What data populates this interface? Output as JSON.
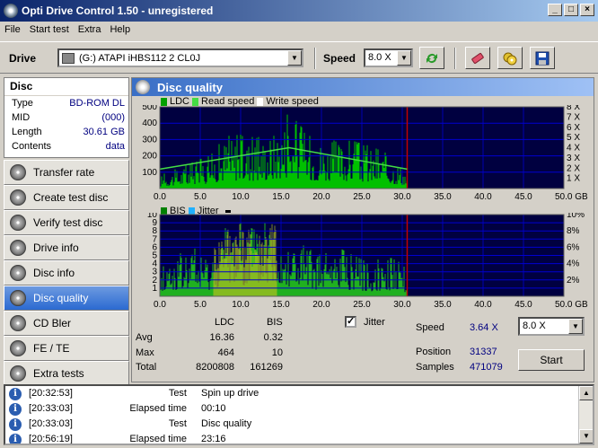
{
  "window": {
    "title": "Opti Drive Control 1.50 - unregistered"
  },
  "menu": [
    "File",
    "Start test",
    "Extra",
    "Help"
  ],
  "toolbar": {
    "drive_label": "Drive",
    "drive_value": "(G:)   ATAPI iHBS112   2 CL0J",
    "speed_label": "Speed",
    "speed_value": "8.0 X"
  },
  "disc": {
    "header": "Disc",
    "rows": [
      {
        "key": "Type",
        "value": "BD-ROM DL"
      },
      {
        "key": "MID",
        "value": "(000)"
      },
      {
        "key": "Length",
        "value": "30.61 GB"
      },
      {
        "key": "Contents",
        "value": "data"
      }
    ]
  },
  "nav": [
    {
      "label": "Transfer rate"
    },
    {
      "label": "Create test disc"
    },
    {
      "label": "Verify test disc"
    },
    {
      "label": "Drive info"
    },
    {
      "label": "Disc info"
    },
    {
      "label": "Disc quality",
      "active": true
    },
    {
      "label": "CD Bler"
    },
    {
      "label": "FE / TE"
    },
    {
      "label": "Extra tests"
    }
  ],
  "panel": {
    "title": "Disc quality"
  },
  "legend_top": {
    "ldc": "LDC",
    "read": "Read speed",
    "write": "Write speed"
  },
  "legend_bottom": {
    "bis": "BIS",
    "jitter": "Jitter"
  },
  "chart_data": [
    {
      "type": "area",
      "name": "LDC chart",
      "x_ticks": [
        "0.0",
        "5.0",
        "10.0",
        "15.0",
        "20.0",
        "25.0",
        "30.0",
        "35.0",
        "40.0",
        "45.0",
        "50.0 GB"
      ],
      "y_left_ticks": [
        "100",
        "200",
        "300",
        "400",
        "500"
      ],
      "y_right_ticks": [
        "1 X",
        "2 X",
        "3 X",
        "4 X",
        "5 X",
        "6 X",
        "7 X",
        "8 X"
      ],
      "xlim": [
        0,
        50
      ],
      "ylim": [
        0,
        500
      ],
      "data_end_gb": 30.61,
      "read_speed": {
        "x": [
          0,
          16,
          30.6
        ],
        "y": [
          1.9,
          4.0,
          1.9
        ]
      },
      "ldc_envelope": {
        "x": [
          0,
          2,
          4,
          6,
          8,
          10,
          12,
          14,
          16,
          18,
          20,
          22,
          24,
          26,
          28,
          30,
          30.6
        ],
        "y": [
          80,
          120,
          160,
          200,
          320,
          330,
          310,
          360,
          464,
          350,
          310,
          300,
          290,
          260,
          220,
          150,
          100
        ]
      },
      "colors": {
        "ldc": "#00c000",
        "read": "#44dd44",
        "grid": "#0000c0",
        "bg": "#000040",
        "marker": "#c00000"
      }
    },
    {
      "type": "area",
      "name": "BIS chart",
      "x_ticks": [
        "0.0",
        "5.0",
        "10.0",
        "15.0",
        "20.0",
        "25.0",
        "30.0",
        "35.0",
        "40.0",
        "45.0",
        "50.0 GB"
      ],
      "y_left_ticks": [
        "1",
        "2",
        "3",
        "4",
        "5",
        "6",
        "7",
        "8",
        "9",
        "10"
      ],
      "y_right_ticks": [
        "2%",
        "4%",
        "6%",
        "8%",
        "10%"
      ],
      "xlim": [
        0,
        50
      ],
      "ylim": [
        0,
        10
      ],
      "data_end_gb": 30.61,
      "bis_envelope": {
        "x": [
          0,
          2,
          4,
          6,
          8,
          10,
          12,
          14,
          16,
          18,
          20,
          22,
          24,
          26,
          28,
          30,
          30.6
        ],
        "y": [
          4,
          5,
          6,
          5,
          9,
          9,
          8,
          10,
          8,
          6,
          5,
          6,
          5,
          4,
          5,
          4,
          3
        ]
      },
      "colors": {
        "bis": "#20b020",
        "bis_mid": "#b0c020"
      }
    }
  ],
  "stats": {
    "col_ldc": "LDC",
    "col_bis": "BIS",
    "rows": [
      {
        "label": "Avg",
        "ldc": "16.36",
        "bis": "0.32"
      },
      {
        "label": "Max",
        "ldc": "464",
        "bis": "10"
      },
      {
        "label": "Total",
        "ldc": "8200808",
        "bis": "161269"
      }
    ],
    "jitter_label": "Jitter",
    "speed_label": "Speed",
    "speed_value": "3.64 X",
    "position_label": "Position",
    "position_value": "31337",
    "samples_label": "Samples",
    "samples_value": "471079",
    "speed_select": "8.0 X",
    "start_label": "Start"
  },
  "log": [
    {
      "time": "[20:32:53]",
      "key": "Test",
      "value": "Spin up drive"
    },
    {
      "time": "[20:33:03]",
      "key": "Elapsed time",
      "value": "00:10"
    },
    {
      "time": "[20:33:03]",
      "key": "Test",
      "value": "Disc quality"
    },
    {
      "time": "[20:56:19]",
      "key": "Elapsed time",
      "value": "23:16"
    }
  ]
}
